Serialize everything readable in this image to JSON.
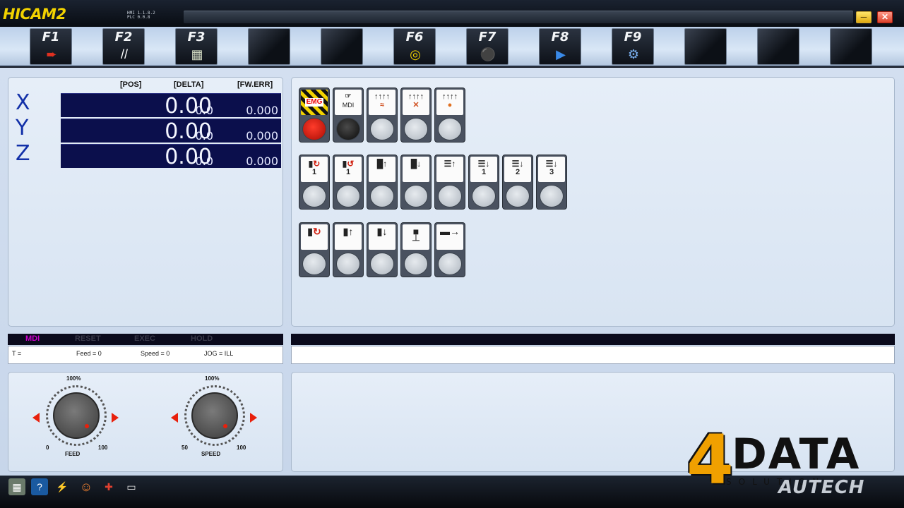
{
  "app": {
    "logo": "HICAM2",
    "version_line1": "HMI 1.1.8.2",
    "version_line2": "PLC 0.0.8"
  },
  "toolbar": {
    "keys": [
      {
        "label": "F1",
        "icon": "arrow-in-icon"
      },
      {
        "label": "F2",
        "icon": "double-slash-icon"
      },
      {
        "label": "F3",
        "icon": "grid-icon"
      },
      {
        "label": "",
        "icon": ""
      },
      {
        "label": "",
        "icon": ""
      },
      {
        "label": "F6",
        "icon": "home-target-icon"
      },
      {
        "label": "F7",
        "icon": "joystick-icon"
      },
      {
        "label": "F8",
        "icon": "play-icon"
      },
      {
        "label": "F9",
        "icon": "gears-icon"
      },
      {
        "label": "",
        "icon": ""
      },
      {
        "label": "",
        "icon": ""
      },
      {
        "label": "",
        "icon": ""
      }
    ]
  },
  "position": {
    "headers": {
      "pos": "[POS]",
      "delta": "[DELTA]",
      "ferr": "[FW.ERR]"
    },
    "axes": [
      {
        "name": "X",
        "pos": "0.00",
        "delta": "0.0",
        "ferr": "0.000"
      },
      {
        "name": "Y",
        "pos": "0.00",
        "delta": "0.0",
        "ferr": "0.000"
      },
      {
        "name": "Z",
        "pos": "0.00",
        "delta": "0.0",
        "ferr": "0.000"
      }
    ]
  },
  "ops": {
    "emg_label": "EMG",
    "mdi_label": "MDI",
    "row2_numbers": [
      "1",
      "1",
      "",
      "",
      "",
      "1",
      "2",
      "3"
    ]
  },
  "status": {
    "modes": [
      "MDI",
      "RESET",
      "EXEC",
      "HOLD"
    ],
    "active_mode": "MDI",
    "t": "T =",
    "feed": "Feed = 0",
    "speed": "Speed = 0",
    "jog": "JOG = ILL"
  },
  "knobs": {
    "feed": {
      "percent": "100%",
      "min": "0",
      "max": "100",
      "label": "FEED"
    },
    "speed": {
      "percent": "100%",
      "min": "50",
      "max": "100",
      "label": "SPEED"
    }
  },
  "brand": {
    "four": "4",
    "data": "DATA",
    "solution": "SOLUTION",
    "autech": "AUTECH"
  },
  "colors": {
    "logo_yellow": "#f2d200",
    "axis_blue": "#1230a8",
    "panel_bg": "#e6eef8",
    "active_mode": "#c800c8",
    "knob_arrow": "#e8200c"
  }
}
